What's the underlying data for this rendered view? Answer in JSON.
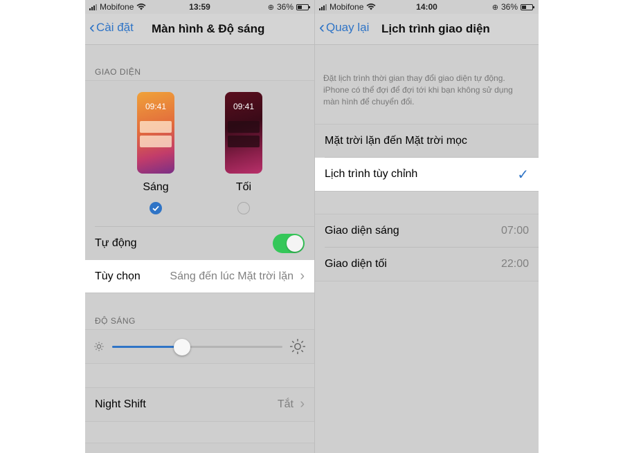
{
  "left_screen": {
    "status": {
      "carrier": "Mobifone",
      "time": "13:59",
      "battery": "36%"
    },
    "nav": {
      "back": "Cài đặt",
      "title": "Màn hình & Độ sáng"
    },
    "appearance_label": "GIAO DIỆN",
    "light": {
      "clock": "09:41",
      "label": "Sáng",
      "selected": true
    },
    "dark": {
      "clock": "09:41",
      "label": "Tối",
      "selected": false
    },
    "auto": {
      "label": "Tự động",
      "on": true
    },
    "options": {
      "label": "Tùy chọn",
      "value": "Sáng đến lúc Mặt trời lặn"
    },
    "brightness_label": "ĐỘ SÁNG",
    "brightness_level": 0.41,
    "night_shift": {
      "label": "Night Shift",
      "value": "Tắt"
    }
  },
  "right_screen": {
    "status": {
      "carrier": "Mobifone",
      "time": "14:00",
      "battery": "36%"
    },
    "nav": {
      "back": "Quay lại",
      "title": "Lịch trình giao diện"
    },
    "description": "Đặt lịch trình thời gian thay đổi giao diện tự động. iPhone có thể đợi để đợi tới khi bạn không sử dụng màn hình để chuyển đổi.",
    "options": [
      {
        "label": "Mặt trời lặn đến Mặt trời mọc",
        "checked": false
      },
      {
        "label": "Lịch trình tùy chỉnh",
        "checked": true
      }
    ],
    "light_appearance": {
      "label": "Giao diện sáng",
      "time": "07:00"
    },
    "dark_appearance": {
      "label": "Giao diện tối",
      "time": "22:00"
    }
  },
  "colors": {
    "accent": "#2f74c6",
    "toggle_on": "#35c759",
    "dimmed_bg": "#cfcfcf"
  }
}
